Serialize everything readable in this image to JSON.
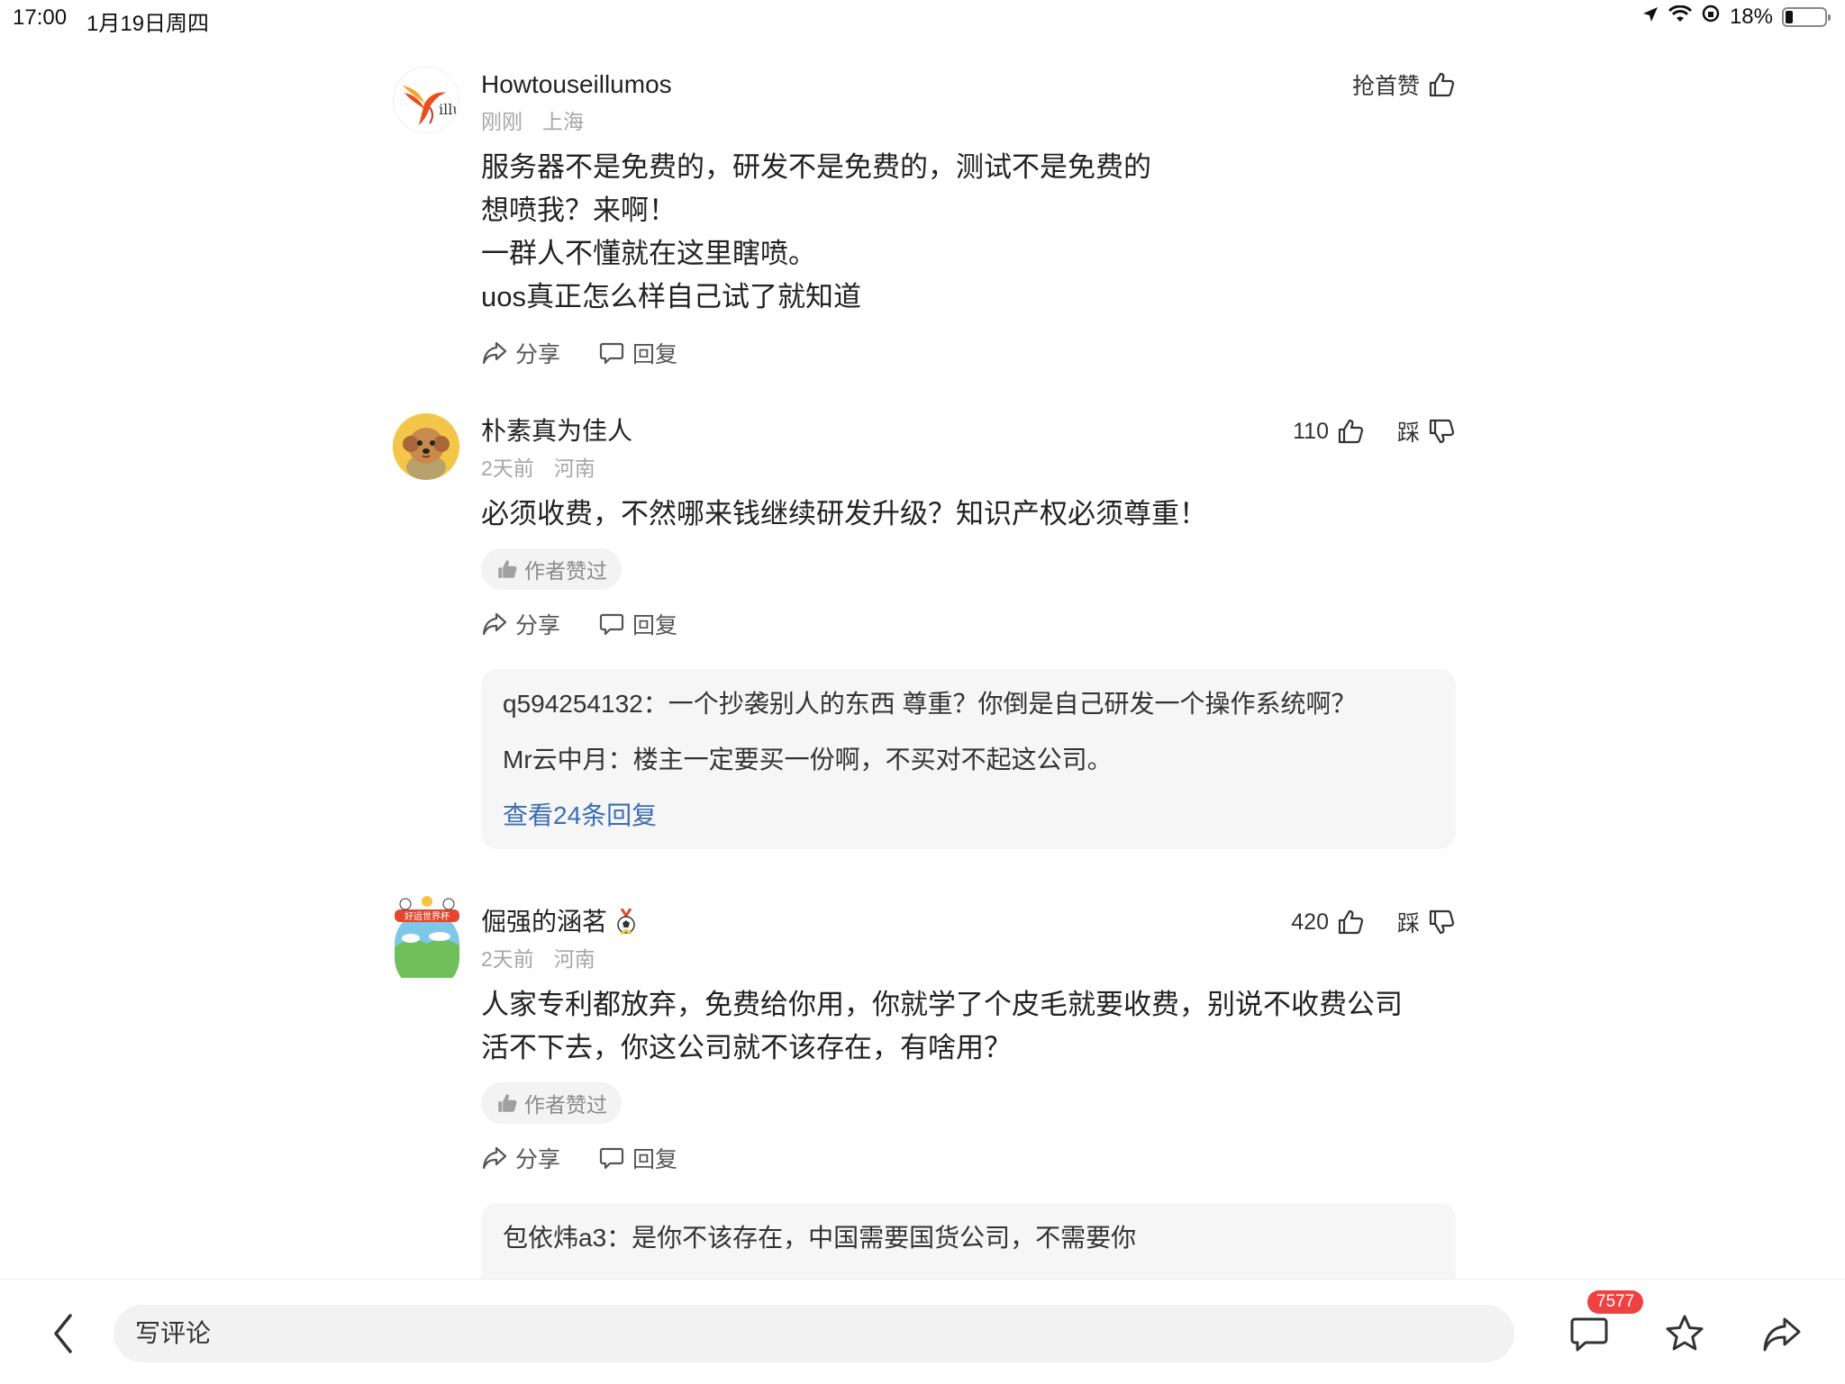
{
  "status": {
    "time": "17:00",
    "date": "1月19日周四",
    "battery": "18%",
    "battery_level": 0.18
  },
  "comments": [
    {
      "user": "Howtouseillumos",
      "avatar": "bird-logo-avatar",
      "time": "刚刚",
      "location": "上海",
      "lines": [
        "服务器不是免费的，研发不是免费的，测试不是免费的",
        "想喷我？来啊！",
        "一群人不懂就在这里瞎喷。",
        "uos真正怎么样自己试了就知道"
      ],
      "like_label": "抢首赞",
      "share": "分享",
      "reply": "回复"
    },
    {
      "user": "朴素真为佳人",
      "avatar": "dog-avatar",
      "time": "2天前",
      "location": "河南",
      "lines": [
        "必须收费，不然哪来钱继续研发升级？知识产权必须尊重！"
      ],
      "likes": "110",
      "dislike_label": "踩",
      "author_liked": "作者赞过",
      "share": "分享",
      "reply": "回复",
      "replies": [
        {
          "user": "q594254132",
          "text": "一个抄袭别人的东西 尊重？你倒是自己研发一个操作系统啊？"
        },
        {
          "user": "Mr云中月",
          "text": "楼主一定要买一份啊，不买对不起这公司。"
        }
      ],
      "more_replies": "查看24条回复"
    },
    {
      "user": "倔强的涵茗",
      "avatar": "world-cup-avatar",
      "avatar_badge": "好运世界杯",
      "badge_icon": "soccer-medal-icon",
      "time": "2天前",
      "location": "河南",
      "lines": [
        "人家专利都放弃，免费给你用，你就学了个皮毛就要收费，别说不收费公司",
        "活不下去，你这公司就不该存在，有啥用？"
      ],
      "likes": "420",
      "dislike_label": "踩",
      "author_liked": "作者赞过",
      "share": "分享",
      "reply": "回复",
      "replies": [
        {
          "user": "包依炜a3",
          "text": "是你不该存在，中国需要国货公司，不需要你"
        }
      ]
    }
  ],
  "bottom": {
    "placeholder": "写评论",
    "comment_count": "7577"
  },
  "colors": {
    "link": "#3b6db3",
    "badge": "#f04142",
    "muted": "#a7a7a7"
  }
}
